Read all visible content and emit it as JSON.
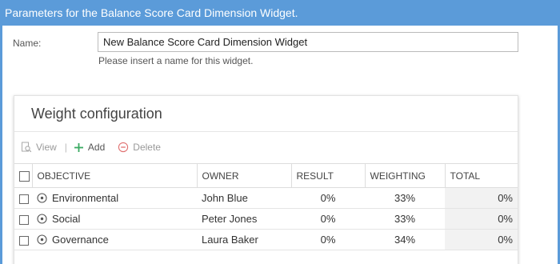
{
  "window": {
    "title": "Parameters for the Balance Score Card Dimension Widget."
  },
  "form": {
    "name_label": "Name:",
    "name_value": "New Balance Score Card Dimension Widget",
    "name_help": "Please insert a name for this widget."
  },
  "panel": {
    "title": "Weight configuration",
    "toolbar": {
      "view_label": "View",
      "view_icon": "view-icon",
      "divider": "|",
      "add_label": "Add",
      "add_icon": "plus-icon",
      "delete_label": "Delete",
      "delete_icon": "minus-circle-icon"
    },
    "columns": {
      "objective": "OBJECTIVE",
      "owner": "OWNER",
      "result": "RESULT",
      "weighting": "WEIGHTING",
      "total": "TOTAL"
    },
    "rows": [
      {
        "objective": "Environmental",
        "owner": "John Blue",
        "result": "0%",
        "weighting": "33%",
        "total": "0%"
      },
      {
        "objective": "Social",
        "owner": "Peter Jones",
        "result": "0%",
        "weighting": "33%",
        "total": "0%"
      },
      {
        "objective": "Governance",
        "owner": "Laura Baker",
        "result": "0%",
        "weighting": "34%",
        "total": "0%"
      }
    ]
  },
  "colors": {
    "title_bar": "#5b9bd9",
    "add_green": "#3aaa62",
    "delete_red": "#e07070",
    "total_cell_bg": "#f2f2f2"
  }
}
